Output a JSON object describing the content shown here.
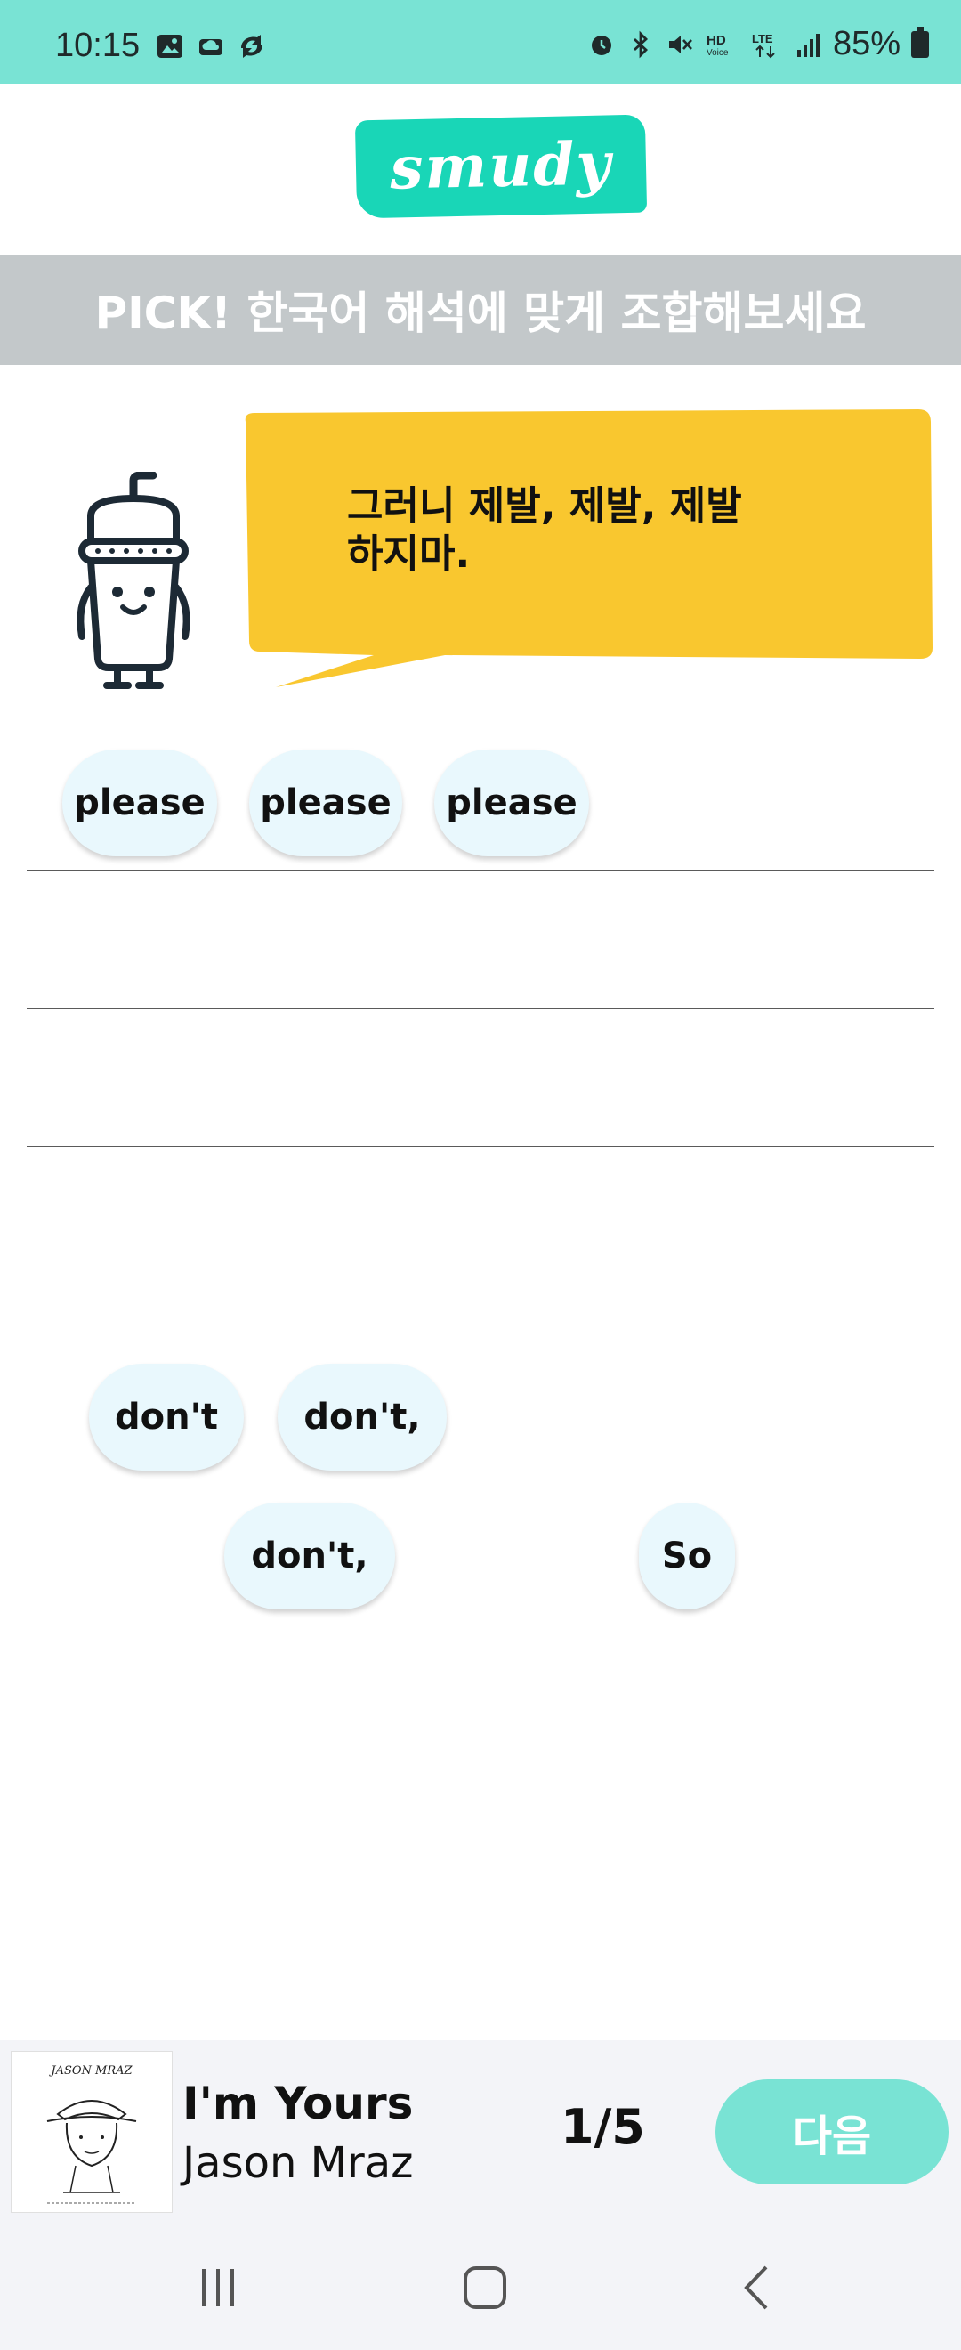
{
  "status_bar": {
    "time": "10:15",
    "battery": "85%",
    "left_icons": [
      "gallery-icon",
      "cloud-icon",
      "sync-icon"
    ],
    "right_icons": [
      "alarm-icon",
      "bluetooth-icon",
      "mute-icon",
      "hd-voice-icon",
      "lte-icon",
      "signal-icon",
      "battery-icon"
    ],
    "background": "#79e3d4"
  },
  "header": {
    "logo_text": "smudy",
    "logo_color": "#19d6b7"
  },
  "banner": {
    "text": "PICK! 한국어 해석에 맞게 조합해보세요",
    "background": "#c3c8ca"
  },
  "prompt": {
    "korean_line1": "그러니 제발, 제발, 제발",
    "korean_line2": "하지마.",
    "bubble_color": "#f9c72f"
  },
  "selected_words": [
    "please",
    "please",
    "please"
  ],
  "word_bank": [
    "don't",
    "don't,",
    "don't,",
    "So"
  ],
  "player": {
    "song_title": "I'm Yours",
    "artist": "Jason Mraz",
    "album_caption": "JASON MRAZ",
    "progress": "1/5",
    "next_label": "다음",
    "next_color": "#79e3d4"
  }
}
